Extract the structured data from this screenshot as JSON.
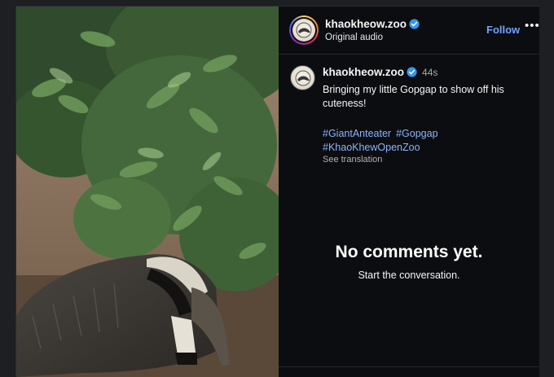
{
  "post": {
    "username": "khaokheow.zoo",
    "audio_label": "Original audio",
    "follow_label": "Follow",
    "more_label": "•••",
    "caption": {
      "username": "khaokheow.zoo",
      "time": "44s",
      "text": "Bringing my little Gopgap to show off his cuteness!",
      "hashtags": [
        "#GiantAnteater",
        "#Gopgap",
        "#KhaoKhewOpenZoo"
      ],
      "see_translation": "See translation"
    },
    "comments": {
      "empty_title": "No comments yet.",
      "empty_subtitle": "Start the conversation."
    }
  },
  "media": {
    "subject": "giant anteater photo"
  },
  "icons": {
    "verified": "verified-badge-icon",
    "more": "more-options-icon"
  },
  "colors": {
    "background": "#0c0d10",
    "link": "#6fa2ff",
    "hashtag": "#8ab4ff",
    "verified": "#3897f0"
  }
}
